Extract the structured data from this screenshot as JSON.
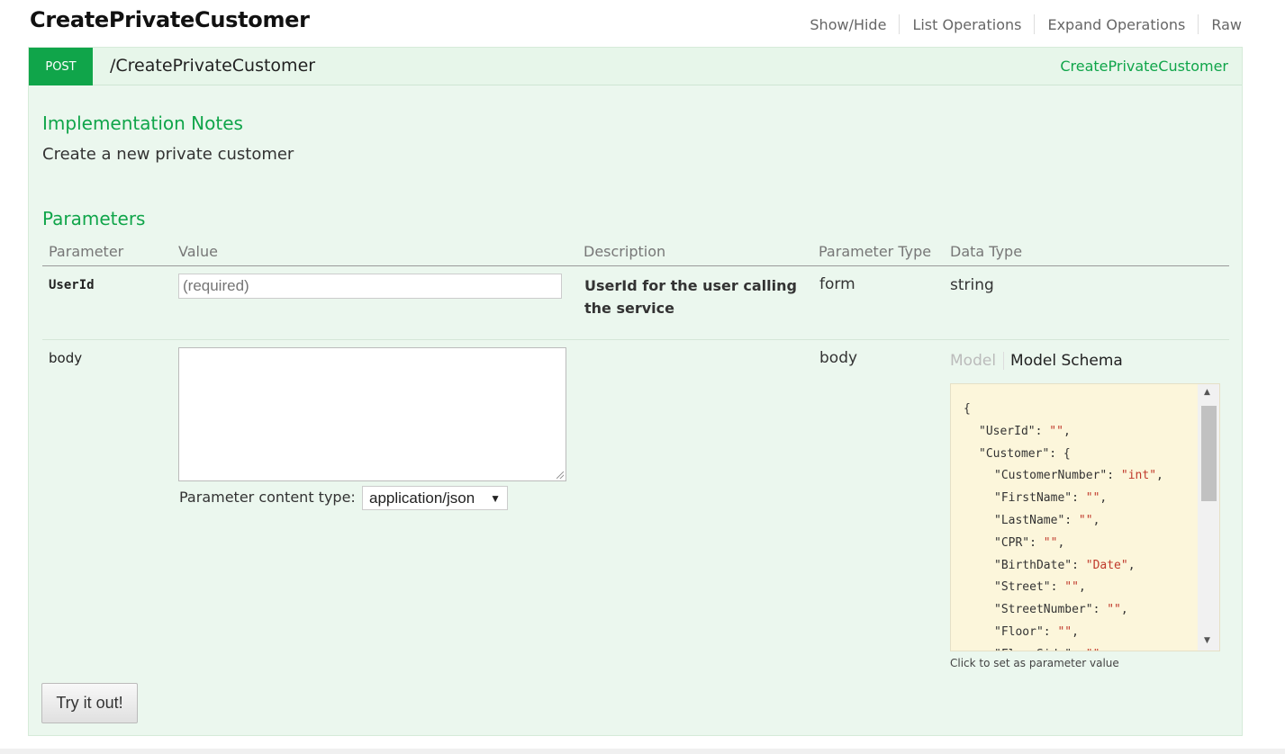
{
  "resource": {
    "title": "CreatePrivateCustomer",
    "links": [
      "Show/Hide",
      "List Operations",
      "Expand Operations",
      "Raw"
    ]
  },
  "operation": {
    "method": "POST",
    "path": "/CreatePrivateCustomer",
    "nickname": "CreatePrivateCustomer",
    "implementation_notes_title": "Implementation Notes",
    "implementation_notes": "Create a new private customer",
    "parameters_title": "Parameters",
    "columns": [
      "Parameter",
      "Value",
      "Description",
      "Parameter Type",
      "Data Type"
    ],
    "params": [
      {
        "name": "UserId",
        "placeholder": "(required)",
        "description": "UserId for the user calling the service",
        "param_type": "form",
        "data_type": "string"
      },
      {
        "name": "body",
        "content_type_label": "Parameter content type:",
        "content_type": "application/json",
        "param_type": "body",
        "model_tab": "Model",
        "schema_tab": "Model Schema",
        "schema_lines": [
          {
            "indent": 0,
            "key": "{",
            "val": ""
          },
          {
            "indent": 1,
            "key": "\"UserId\": ",
            "val": "\"\"",
            "tail": ","
          },
          {
            "indent": 1,
            "key": "\"Customer\": {",
            "val": ""
          },
          {
            "indent": 2,
            "key": "\"CustomerNumber\": ",
            "val": "\"int\"",
            "tail": ","
          },
          {
            "indent": 2,
            "key": "\"FirstName\": ",
            "val": "\"\"",
            "tail": ","
          },
          {
            "indent": 2,
            "key": "\"LastName\": ",
            "val": "\"\"",
            "tail": ","
          },
          {
            "indent": 2,
            "key": "\"CPR\": ",
            "val": "\"\"",
            "tail": ","
          },
          {
            "indent": 2,
            "key": "\"BirthDate\": ",
            "val": "\"Date\"",
            "tail": ","
          },
          {
            "indent": 2,
            "key": "\"Street\": ",
            "val": "\"\"",
            "tail": ","
          },
          {
            "indent": 2,
            "key": "\"StreetNumber\": ",
            "val": "\"\"",
            "tail": ","
          },
          {
            "indent": 2,
            "key": "\"Floor\": ",
            "val": "\"\"",
            "tail": ","
          },
          {
            "indent": 2,
            "key": "\"FloorSide\": ",
            "val": "\"\"",
            "tail": ","
          }
        ],
        "schema_hint": "Click to set as parameter value"
      }
    ],
    "try_button": "Try it out!"
  },
  "colors": {
    "post_green": "#10a54a",
    "panel_bg": "#ebf7ee",
    "snippet_bg": "#fcf6db",
    "string_red": "#c0392b"
  }
}
